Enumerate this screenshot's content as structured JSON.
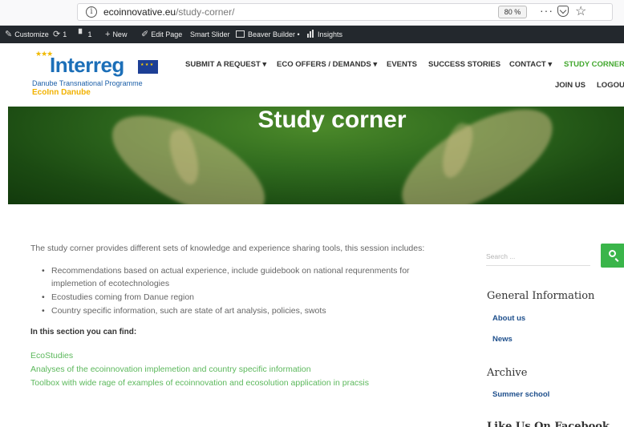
{
  "browser": {
    "url_domain": "ecoinnovative.eu",
    "url_path": "/study-corner/",
    "zoom": "80 %",
    "info_icon": "ⓘ",
    "more_icon": "more-icon",
    "pocket_icon": "pocket-icon",
    "bookmark_icon": "star-icon"
  },
  "admin_bar": {
    "customize": "Customize",
    "updates_count": "1",
    "comments_count": "1",
    "new": "New",
    "edit_page": "Edit Page",
    "smart_slider": "Smart Slider",
    "beaver_builder": "Beaver Builder",
    "insights": "Insights"
  },
  "logo": {
    "wordmark": "Interreg",
    "subtitle": "Danube Transnational Programme",
    "project": "EcoInn Danube"
  },
  "nav": {
    "items": [
      {
        "label": "SUBMIT A REQUEST",
        "dropdown": true
      },
      {
        "label": "ECO OFFERS / DEMANDS",
        "dropdown": true
      },
      {
        "label": "EVENTS",
        "dropdown": false
      },
      {
        "label": "SUCCESS STORIES",
        "dropdown": false
      },
      {
        "label": "CONTACT",
        "dropdown": true
      },
      {
        "label": "STUDY CORNER",
        "dropdown": false,
        "active": true
      }
    ],
    "join_us": "JOIN US",
    "logout": "LOGOUT"
  },
  "hero": {
    "title": "Study corner"
  },
  "content": {
    "intro": "The study corner provides different sets of knowledge and experience sharing tools, this session includes:",
    "bullets": [
      "Recommendations based on actual experience,  include guidebook on national requrenments for implemetion of ecotechnologies",
      "Ecostudies coming from Danue region",
      "Country specific information, such are state of art analysis, policies, swots"
    ],
    "find_heading": "In this section you can find:",
    "links": [
      "EcoStudies",
      "Analyses of the ecoinnovation implemetion and country specific information",
      "Toolbox with wide rage of examples of ecoinnovation and ecosolution application in pracsis"
    ]
  },
  "sidebar": {
    "search_placeholder": "Search ...",
    "general_info_title": "General Information",
    "general_links": [
      "About us",
      "News"
    ],
    "archive_title": "Archive",
    "archive_links": [
      "Summer school"
    ],
    "facebook_title": "Like Us On Facebook"
  },
  "colors": {
    "accent_green": "#3ab54a",
    "admin_bar": "#23282d",
    "link_blue": "#1e4f8c",
    "logo_blue": "#1c6fb8",
    "logo_yellow": "#f2b200"
  }
}
